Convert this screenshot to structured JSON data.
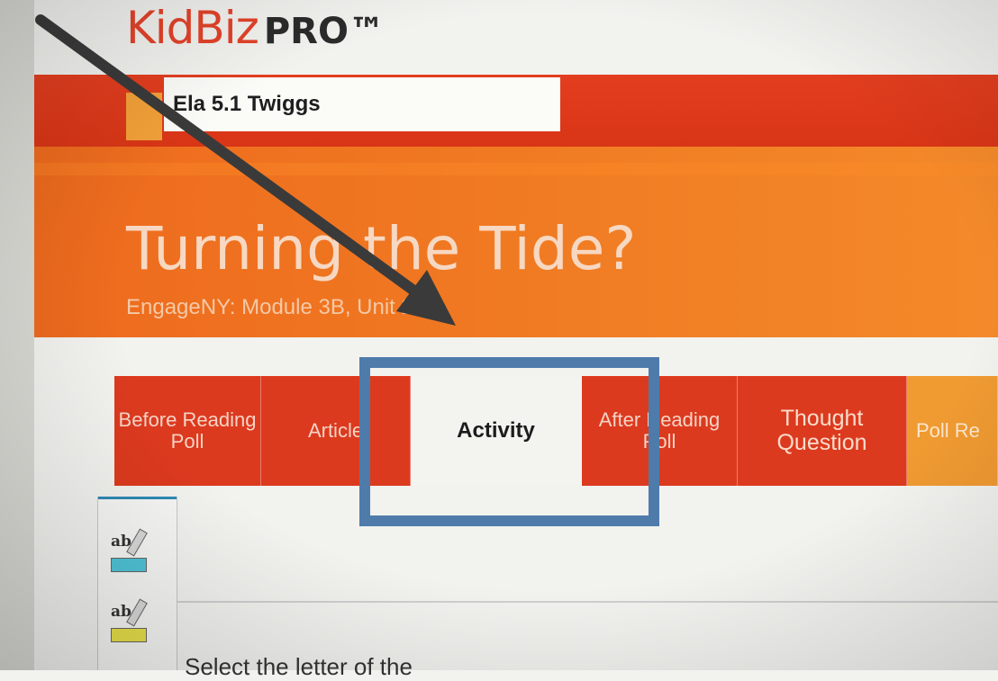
{
  "logo": {
    "brand": "KidBiz",
    "suffix": "PRO™"
  },
  "class_selector": {
    "value": "Ela 5.1 Twiggs"
  },
  "lesson": {
    "title": "Turning the Tide?",
    "subtitle": "EngageNY: Module 3B, Unit 2"
  },
  "tabs": [
    {
      "label": "Before Reading Poll",
      "active": false
    },
    {
      "label": "Article",
      "active": false
    },
    {
      "label": "Activity",
      "active": true
    },
    {
      "label": "After Reading Poll",
      "active": false
    },
    {
      "label": "Thought Question",
      "active": false
    },
    {
      "label": "Poll Re",
      "active": false
    }
  ],
  "toolbar": {
    "tools": [
      {
        "label": "ab",
        "icon": "highlighter-blue-icon",
        "color": "#4fc3d6"
      },
      {
        "label": "ab",
        "icon": "highlighter-yellow-icon",
        "color": "#e8e04a"
      }
    ]
  },
  "content": {
    "partial_text": "Select the letter of the"
  },
  "annotations": {
    "highlight_box_color": "#4f7bab",
    "arrow_color": "#3a3a3a"
  }
}
